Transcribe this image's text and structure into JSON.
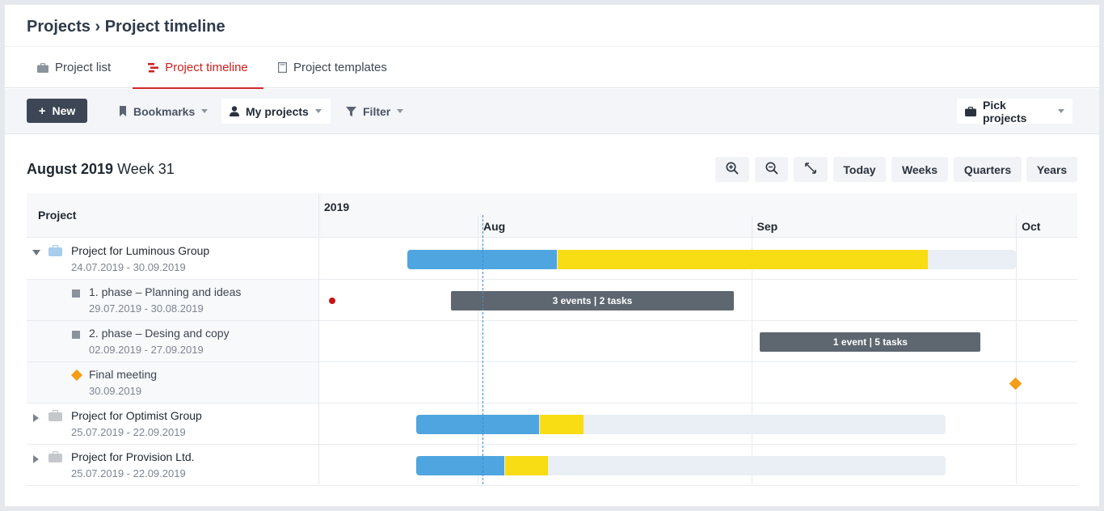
{
  "header": {
    "title": "Projects › Project timeline"
  },
  "tabs": [
    {
      "label": "Project list",
      "icon": "briefcase-icon",
      "active": false
    },
    {
      "label": "Project timeline",
      "icon": "timeline-icon",
      "active": true
    },
    {
      "label": "Project templates",
      "icon": "template-icon",
      "active": false
    }
  ],
  "toolbar": {
    "new_label": "New",
    "bookmarks_label": "Bookmarks",
    "my_projects_label": "My projects",
    "filter_label": "Filter",
    "pick_projects_label": "Pick projects"
  },
  "period": {
    "month_year": "August 2019",
    "week": "Week 31"
  },
  "view_controls": {
    "zoom_in": "zoom-in-icon",
    "zoom_out": "zoom-out-icon",
    "fit": "expand-icon",
    "today_label": "Today",
    "weeks_label": "Weeks",
    "quarters_label": "Quarters",
    "years_label": "Years"
  },
  "timeline": {
    "column_header": "Project",
    "year": "2019",
    "months": [
      "Aug",
      "Sep",
      "Oct"
    ],
    "today": "2019-08-02",
    "colors": {
      "done": "#4fa5e0",
      "in_progress": "#f8dc14",
      "remaining": "#eaeef5",
      "phase": "#5e6670",
      "event": "#c81414",
      "milestone": "#f59d15"
    },
    "rows": [
      {
        "type": "project",
        "expanded": true,
        "name": "Project for Luminous Group",
        "dates": "24.07.2019 - 30.09.2019",
        "icon_color": "#a8cdee",
        "start": "2019-07-24",
        "end": "2019-10-01",
        "done_until": "2019-08-10",
        "progress_until": "2019-09-21"
      },
      {
        "type": "phase",
        "name": "1. phase – Planning and ideas",
        "dates": "29.07.2019 - 30.08.2019",
        "start": "2019-07-29",
        "end": "2019-08-30",
        "bar_label": "3 events | 2 tasks",
        "event_dot": "2019-07-27"
      },
      {
        "type": "phase",
        "name": "2. phase – Desing and copy",
        "dates": "02.09.2019 - 27.09.2019",
        "start": "2019-09-02",
        "end": "2019-09-27",
        "bar_label": "1 event | 5 tasks"
      },
      {
        "type": "milestone",
        "name": "Final meeting",
        "dates": "30.09.2019",
        "date": "2019-10-01"
      },
      {
        "type": "project",
        "expanded": false,
        "name": "Project for Optimist Group",
        "dates": "25.07.2019 - 22.09.2019",
        "icon_color": "#c4c8cd",
        "start": "2019-07-25",
        "end": "2019-09-23",
        "done_until": "2019-08-08",
        "progress_until": "2019-08-13"
      },
      {
        "type": "project",
        "expanded": false,
        "name": "Project for Provision Ltd.",
        "dates": "25.07.2019 - 22.09.2019",
        "icon_color": "#c4c8cd",
        "start": "2019-07-25",
        "end": "2019-09-23",
        "done_until": "2019-08-04",
        "progress_until": "2019-08-09"
      }
    ]
  }
}
